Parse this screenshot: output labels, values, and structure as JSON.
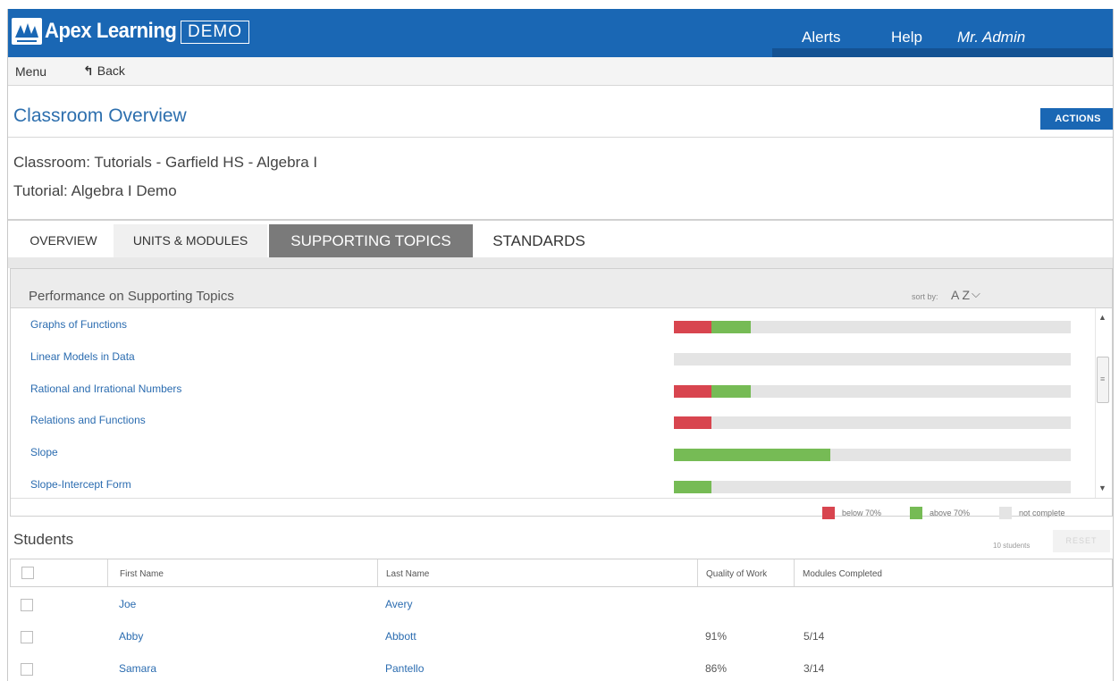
{
  "header": {
    "brand": "Apex Learning",
    "badge": "DEMO",
    "nav": [
      "Alerts",
      "Help",
      "Mr. Admin"
    ]
  },
  "toolbar": {
    "menu": "Menu",
    "back": "Back"
  },
  "page": {
    "title": "Classroom Overview",
    "actions": "ACTIONS",
    "classroom": "Classroom: Tutorials - Garfield HS - Algebra I",
    "tutorial": "Tutorial: Algebra I Demo"
  },
  "tabs": [
    "OVERVIEW",
    "UNITS & MODULES",
    "SUPPORTING TOPICS",
    "STANDARDS"
  ],
  "active_tab": "SUPPORTING TOPICS",
  "performance": {
    "title": "Performance on Supporting Topics",
    "sort_label": "sort by:",
    "sort_value": "A Z",
    "topics": [
      {
        "name": "Graphs of Functions",
        "below": 0.095,
        "above": 0.1
      },
      {
        "name": "Linear Models in Data",
        "below": 0,
        "above": 0
      },
      {
        "name": "Rational and Irrational Numbers",
        "below": 0.095,
        "above": 0.1
      },
      {
        "name": "Relations and Functions",
        "below": 0.095,
        "above": 0
      },
      {
        "name": "Slope",
        "below": 0,
        "above": 0.395
      },
      {
        "name": "Slope-Intercept Form",
        "below": 0,
        "above": 0.095
      }
    ],
    "legend": [
      {
        "label": "below 70%",
        "color": "#d8454f"
      },
      {
        "label": "above 70%",
        "color": "#76bb55"
      },
      {
        "label": "not complete",
        "color": "#e4e4e4"
      }
    ]
  },
  "students": {
    "title": "Students",
    "count": "10 students",
    "reset": "RESET",
    "columns": [
      "First Name",
      "Last Name",
      "Quality of Work",
      "Modules Completed"
    ],
    "rows": [
      {
        "first": "Joe",
        "last": "Avery",
        "quality": "",
        "modules": ""
      },
      {
        "first": "Abby",
        "last": "Abbott",
        "quality": "91%",
        "modules": "5/14"
      },
      {
        "first": "Samara",
        "last": "Pantello",
        "quality": "86%",
        "modules": "3/14"
      }
    ]
  },
  "colors": {
    "brand": "#1a67b4",
    "link": "#2b6cb0",
    "below": "#d8454f",
    "above": "#76bb55"
  },
  "icons": [
    "apex-logo-icon",
    "back-arrow-icon",
    "chevron-down-icon",
    "scroll-up-icon",
    "scroll-down-icon"
  ]
}
